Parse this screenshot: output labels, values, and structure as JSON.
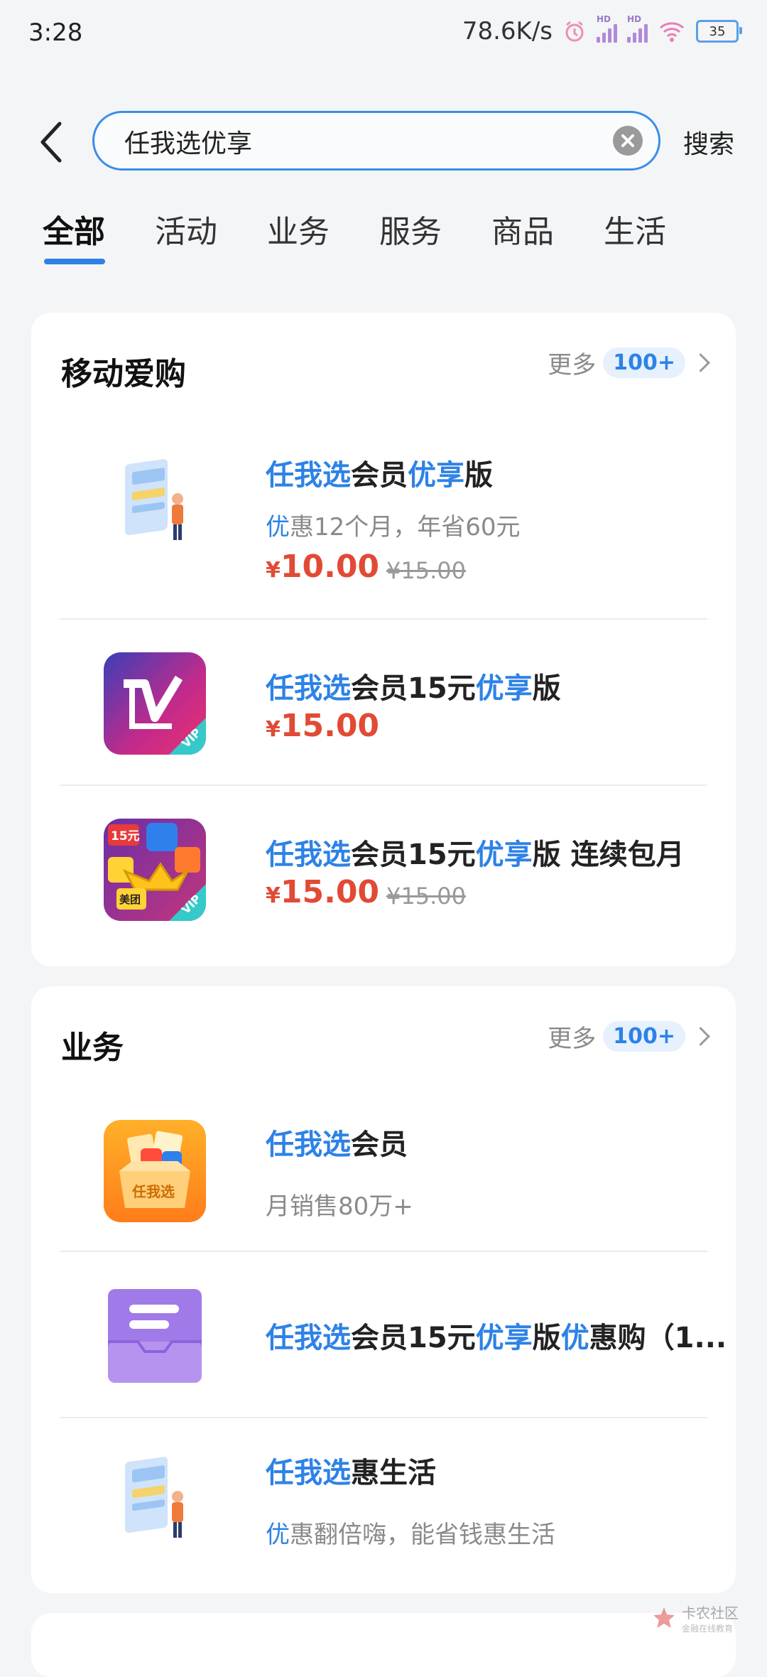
{
  "status": {
    "time": "3:28",
    "speed": "78.6K/s",
    "battery": "35"
  },
  "search": {
    "value": "任我选优享",
    "button": "搜索"
  },
  "tabs": [
    "全部",
    "活动",
    "业务",
    "服务",
    "商品",
    "生活"
  ],
  "colors": {
    "accent": "#2d82e6",
    "price": "#e14a35"
  },
  "sections": [
    {
      "title": "移动爱购",
      "more": "更多",
      "badge": "100+",
      "items": [
        {
          "title_parts": [
            "任我选",
            "会员",
            "优享",
            "版"
          ],
          "subtitle_parts": [
            "优",
            "惠12个月，年省60元"
          ],
          "price_symbol": "¥",
          "price": "10.00",
          "original_price": "¥15.00",
          "icon": "member-illustration-icon"
        },
        {
          "title_parts": [
            "任我选",
            "会员15元",
            "优享",
            "版"
          ],
          "price_symbol": "¥",
          "price": "15.00",
          "icon": "vip-v-logo-icon"
        },
        {
          "title_parts": [
            "任我选",
            "会员15元",
            "优享",
            "版 连续包月"
          ],
          "price_symbol": "¥",
          "price": "15.00",
          "original_price": "¥15.00",
          "icon": "vip-crown-apps-icon",
          "icon_text": [
            "15元",
            "美团",
            "VIP"
          ]
        }
      ]
    },
    {
      "title": "业务",
      "more": "更多",
      "badge": "100+",
      "items": [
        {
          "title_parts": [
            "任我选",
            "会员"
          ],
          "subtitle": "月销售80万+",
          "icon": "gift-box-icon",
          "icon_text": "任我选"
        },
        {
          "title_parts": [
            "任我选",
            "会员15元",
            "优享",
            "版",
            "优",
            "惠购（1..."
          ],
          "icon": "document-tray-icon"
        },
        {
          "title_parts": [
            "任我选",
            "惠生活"
          ],
          "subtitle_parts": [
            "优",
            "惠翻倍嗨，能省钱惠生活"
          ],
          "icon": "member-illustration-icon"
        }
      ]
    }
  ],
  "watermark": {
    "name": "卡农社区",
    "tagline": "金融在线教育"
  }
}
